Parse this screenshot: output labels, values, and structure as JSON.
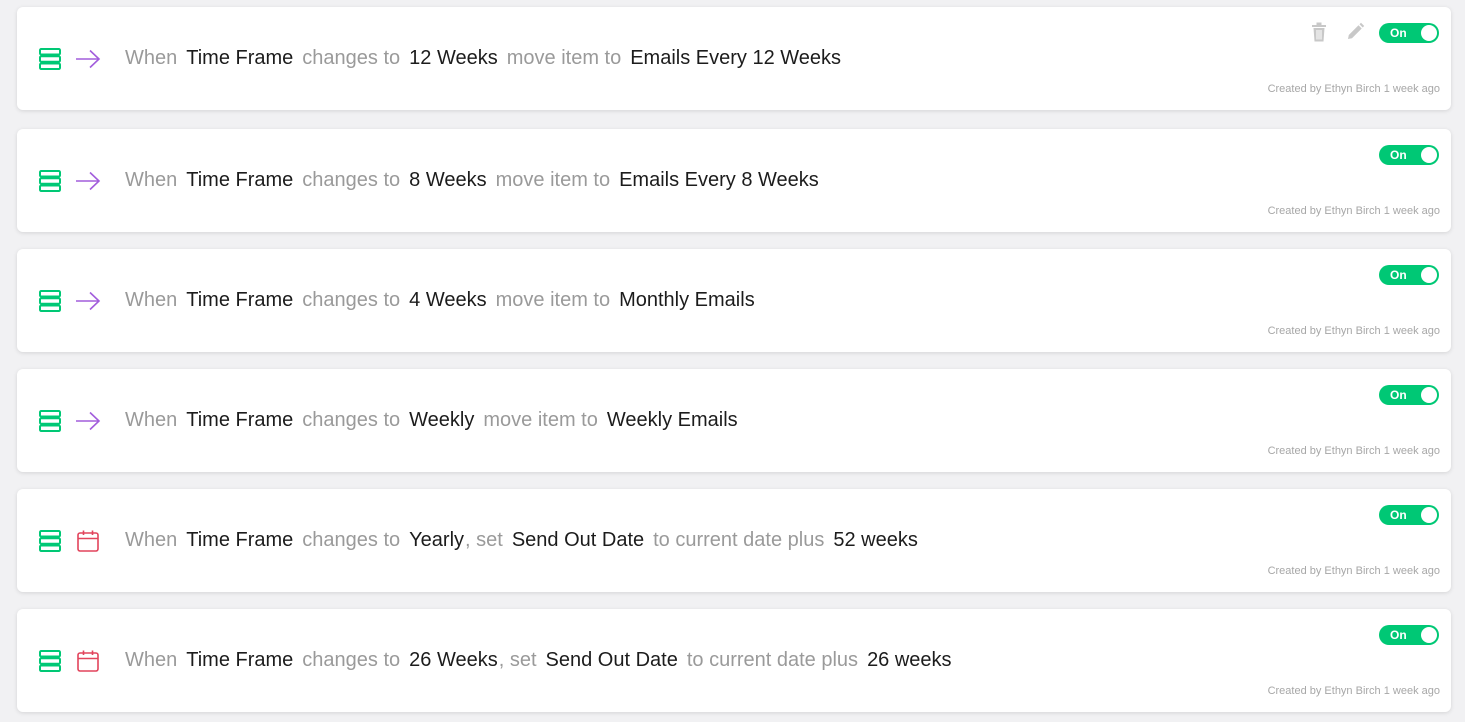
{
  "colors": {
    "toggle_on": "#00c875",
    "board_icon": "#00c875",
    "arrow_icon": "#a25ddc",
    "calendar_icon": "#e2445c",
    "light_text": "#9a9a9a",
    "bold_text": "#1c1c1c"
  },
  "automations": [
    {
      "action_icon": "arrow-right-icon",
      "toggle": "On",
      "show_actions": true,
      "created": "Created by Ethyn Birch 1 week ago",
      "parts": [
        {
          "t": "When",
          "s": "light"
        },
        {
          "t": "Time Frame",
          "s": "bold"
        },
        {
          "t": "changes to",
          "s": "light"
        },
        {
          "t": "12 Weeks",
          "s": "bold"
        },
        {
          "t": "move item to",
          "s": "light"
        },
        {
          "t": "Emails Every 12 Weeks",
          "s": "bold"
        }
      ]
    },
    {
      "action_icon": "arrow-right-icon",
      "toggle": "On",
      "show_actions": false,
      "created": "Created by Ethyn Birch 1 week ago",
      "parts": [
        {
          "t": "When",
          "s": "light"
        },
        {
          "t": "Time Frame",
          "s": "bold"
        },
        {
          "t": "changes to",
          "s": "light"
        },
        {
          "t": "8 Weeks",
          "s": "bold"
        },
        {
          "t": "move item to",
          "s": "light"
        },
        {
          "t": "Emails Every 8 Weeks",
          "s": "bold"
        }
      ]
    },
    {
      "action_icon": "arrow-right-icon",
      "toggle": "On",
      "show_actions": false,
      "created": "Created by Ethyn Birch 1 week ago",
      "parts": [
        {
          "t": "When",
          "s": "light"
        },
        {
          "t": "Time Frame",
          "s": "bold"
        },
        {
          "t": "changes to",
          "s": "light"
        },
        {
          "t": "4 Weeks",
          "s": "bold"
        },
        {
          "t": "move item to",
          "s": "light"
        },
        {
          "t": "Monthly Emails",
          "s": "bold"
        }
      ]
    },
    {
      "action_icon": "arrow-right-icon",
      "toggle": "On",
      "show_actions": false,
      "created": "Created by Ethyn Birch 1 week ago",
      "parts": [
        {
          "t": "When",
          "s": "light"
        },
        {
          "t": "Time Frame",
          "s": "bold"
        },
        {
          "t": "changes to",
          "s": "light"
        },
        {
          "t": "Weekly",
          "s": "bold"
        },
        {
          "t": "move item to",
          "s": "light"
        },
        {
          "t": "Weekly Emails",
          "s": "bold"
        }
      ]
    },
    {
      "action_icon": "calendar-icon",
      "toggle": "On",
      "show_actions": false,
      "created": "Created by Ethyn Birch 1 week ago",
      "parts": [
        {
          "t": "When",
          "s": "light"
        },
        {
          "t": "Time Frame",
          "s": "bold"
        },
        {
          "t": "changes to",
          "s": "light"
        },
        {
          "t": "Yearly",
          "s": "bold"
        },
        {
          "t": ", set",
          "s": "comma"
        },
        {
          "t": "Send Out Date",
          "s": "bold"
        },
        {
          "t": "to current date plus",
          "s": "light"
        },
        {
          "t": "52 weeks",
          "s": "bold"
        }
      ]
    },
    {
      "action_icon": "calendar-icon",
      "toggle": "On",
      "show_actions": false,
      "created": "Created by Ethyn Birch 1 week ago",
      "parts": [
        {
          "t": "When",
          "s": "light"
        },
        {
          "t": "Time Frame",
          "s": "bold"
        },
        {
          "t": "changes to",
          "s": "light"
        },
        {
          "t": "26 Weeks",
          "s": "bold"
        },
        {
          "t": ", set",
          "s": "comma"
        },
        {
          "t": "Send Out Date",
          "s": "bold"
        },
        {
          "t": "to current date plus",
          "s": "light"
        },
        {
          "t": "26 weeks",
          "s": "bold"
        }
      ]
    }
  ]
}
